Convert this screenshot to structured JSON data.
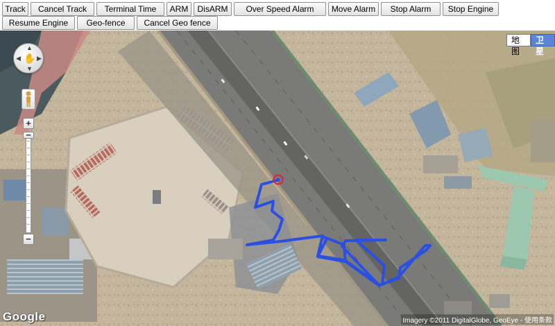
{
  "toolbar": {
    "buttons": [
      {
        "label": "Track"
      },
      {
        "label": "Cancel Track"
      },
      {
        "label": "Terminal Time"
      },
      {
        "label": "ARM"
      },
      {
        "label": "DisARM"
      },
      {
        "label": "Over Speed Alarm"
      },
      {
        "label": "Move Alarm"
      },
      {
        "label": "Stop Alarm"
      },
      {
        "label": "Stop Engine"
      },
      {
        "label": "Resume Engine"
      },
      {
        "label": "Geo-fence"
      },
      {
        "label": "Cancel Geo fence"
      }
    ]
  },
  "map": {
    "type_buttons": {
      "map": "地图",
      "satellite": "卫星"
    },
    "selected_type": "satellite",
    "logo": "Google",
    "attribution": "Imagery ©2011 DigitalGlobe, GeoEye - 使用条款",
    "zoom_in_icon": "plus-icon",
    "zoom_out_icon": "minus-icon",
    "colors": {
      "track": "#2b4fe0",
      "marker": "#e0203a",
      "road": "#6d6d6b",
      "lot": "#dcd2c3"
    }
  }
}
